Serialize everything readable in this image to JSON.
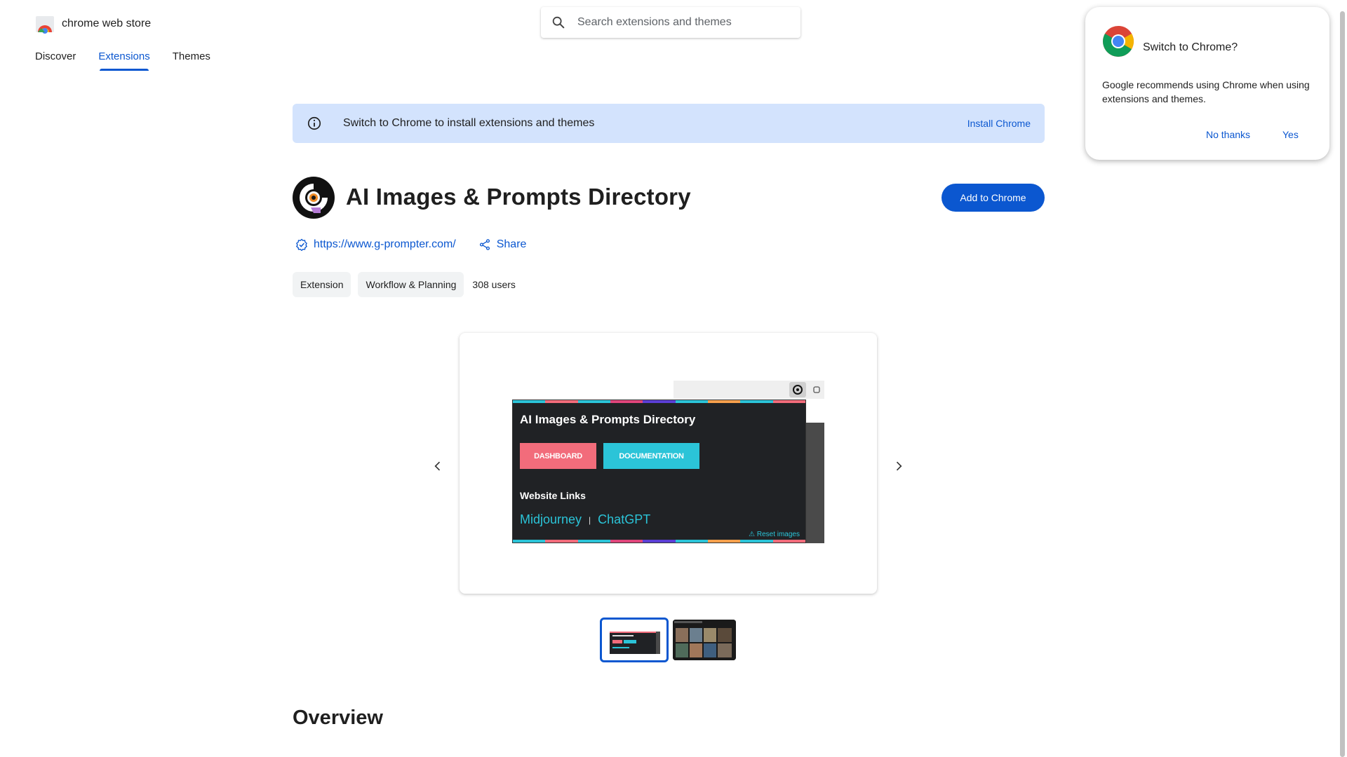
{
  "header": {
    "store_name": "chrome web store",
    "search_placeholder": "Search extensions and themes",
    "nav": [
      {
        "label": "Discover"
      },
      {
        "label": "Extensions"
      },
      {
        "label": "Themes"
      }
    ]
  },
  "banner": {
    "text": "Switch to Chrome to install extensions and themes",
    "action": "Install Chrome"
  },
  "extension": {
    "title": "AI Images & Prompts Directory",
    "add_button": "Add to Chrome",
    "website": "https://www.g-prompter.com/",
    "share_label": "Share",
    "chips": [
      "Extension",
      "Workflow & Planning"
    ],
    "users": "308 users"
  },
  "screenshot": {
    "title": "AI Images & Prompts Directory",
    "button_1": "DASHBOARD",
    "button_2": "DOCUMENTATION",
    "subtitle": "Website Links",
    "link_1": "Midjourney",
    "separator": "|",
    "link_2": "ChatGPT",
    "reset": "⚠ Reset images"
  },
  "section": {
    "overview_heading": "Overview"
  },
  "popup": {
    "title": "Switch to Chrome?",
    "body": "Google recommends using Chrome when using extensions and themes.",
    "no_label": "No thanks",
    "yes_label": "Yes"
  },
  "colors": {
    "accent": "#0b57d0",
    "banner_bg": "#d3e3fd",
    "pink_button": "#f26c7b",
    "cyan_button": "#2bc4d8"
  },
  "icons": {
    "search": "search-icon",
    "info": "info-icon",
    "verified": "verified-icon",
    "share": "share-icon",
    "prev": "chevron-left-icon",
    "next": "chevron-right-icon"
  }
}
